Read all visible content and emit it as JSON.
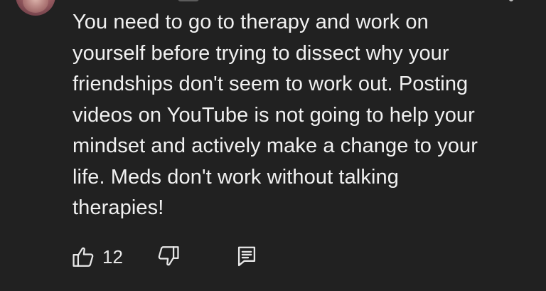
{
  "comment": {
    "lines": [
      "You need to go to therapy and work on",
      "yourself before trying to dissect why your",
      "friendships don't seem to work out. Posting",
      "videos on YouTube is not going to help your",
      "mindset and actively make a change to your",
      "life. Meds don't work without talking",
      "therapies!"
    ]
  },
  "actions": {
    "like_count": "12",
    "like_icon": "thumbs-up-icon",
    "dislike_icon": "thumbs-down-icon",
    "reply_icon": "reply-comment-icon"
  },
  "colors": {
    "background": "#212121",
    "text": "#f1f1f1"
  }
}
